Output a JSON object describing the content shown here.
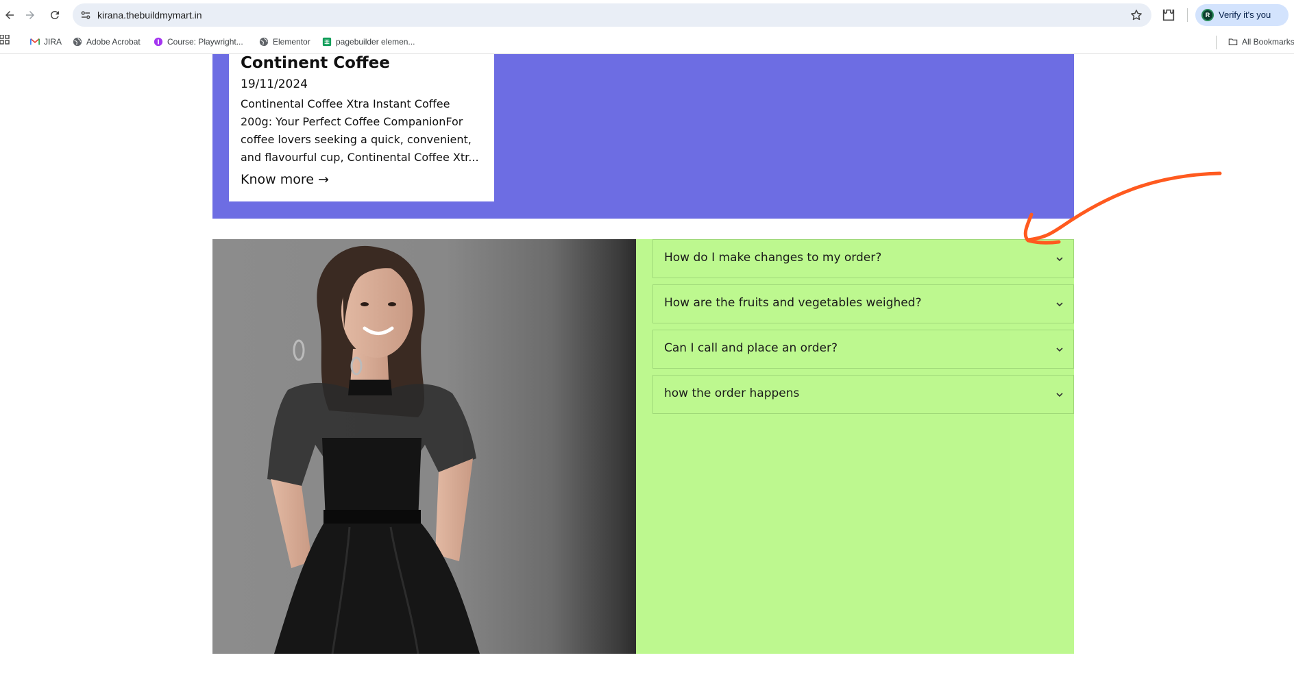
{
  "browser": {
    "url": "kirana.thebuildmymart.in",
    "verify_label": "Verify it's you",
    "avatar_letter": "R",
    "bookmarks": [
      {
        "label": "JIRA",
        "icon": "gmail-icon"
      },
      {
        "label": "Adobe Acrobat",
        "icon": "globe-icon"
      },
      {
        "label": "Course: Playwright...",
        "icon": "course-icon"
      },
      {
        "label": "Elementor",
        "icon": "globe-icon"
      },
      {
        "label": "pagebuilder elemen...",
        "icon": "sheets-icon"
      }
    ],
    "all_bookmarks_label": "All Bookmarks"
  },
  "blog_card": {
    "title": "Continent Coffee",
    "date": "19/11/2024",
    "excerpt": "Continental Coffee Xtra Instant Coffee 200g: Your Perfect Coffee CompanionFor coffee lovers seeking a quick, convenient, and flavourful cup, Continental Coffee Xtr...",
    "link_label": "Know more →"
  },
  "faq": {
    "items": [
      {
        "question": "How do I make changes to my order?"
      },
      {
        "question": "How are the fruits and vegetables weighed?"
      },
      {
        "question": "Can I call and place an order?"
      },
      {
        "question": "how the order happens"
      }
    ]
  },
  "colors": {
    "purple_section": "#6d6de3",
    "faq_background": "#bdf88f",
    "annotation_arrow": "#ff5a1f"
  }
}
